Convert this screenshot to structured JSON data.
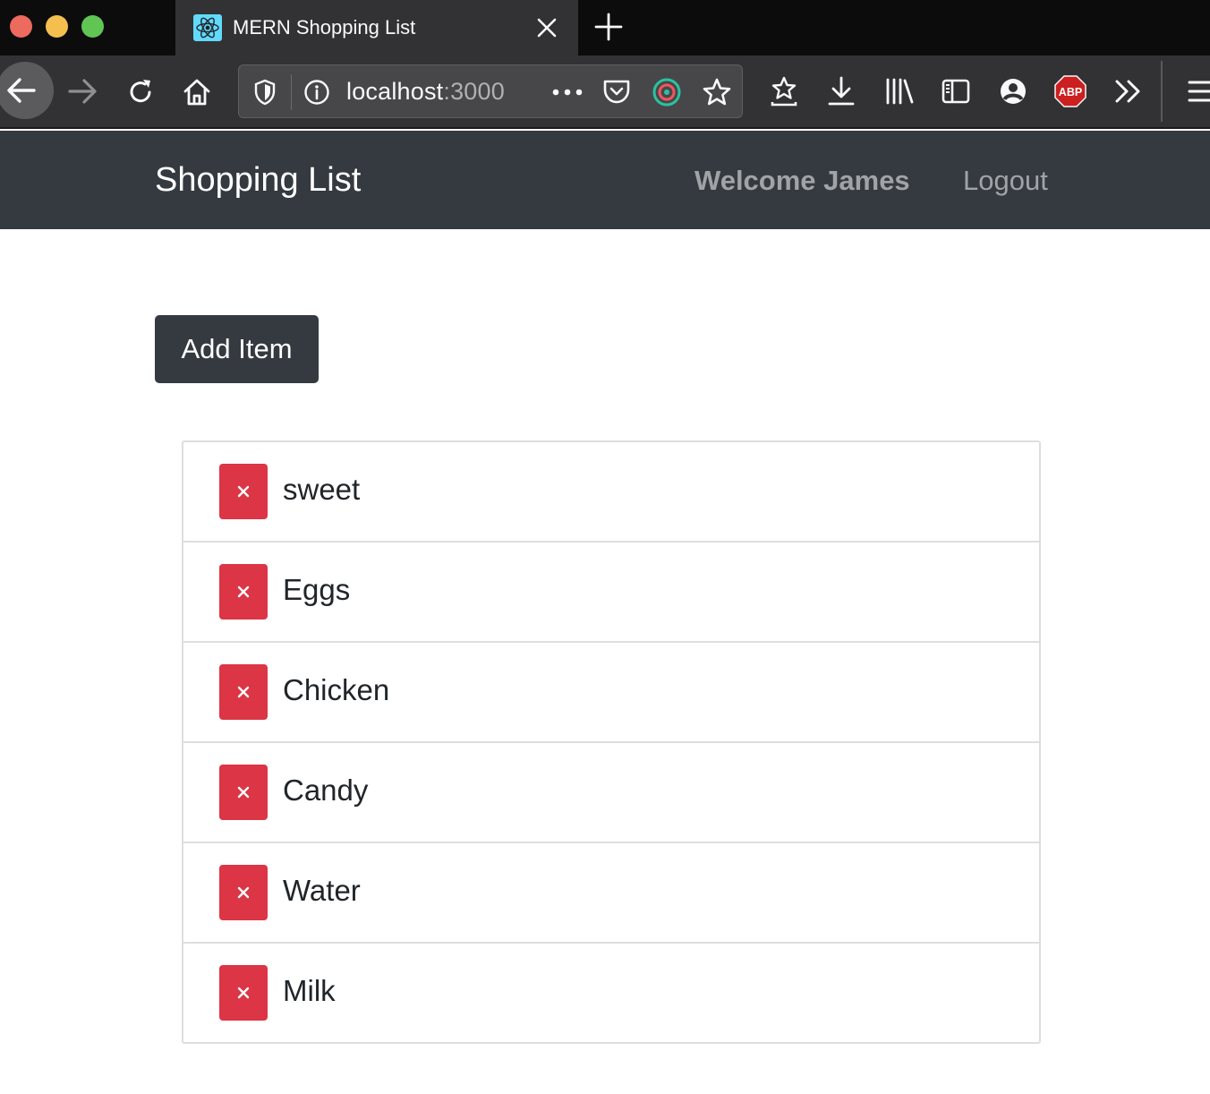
{
  "browser": {
    "tab_title": "MERN Shopping List",
    "url_host": "localhost",
    "url_port": ":3000",
    "adblock_label": "ABP"
  },
  "app": {
    "brand": "Shopping List",
    "welcome": "Welcome James",
    "logout": "Logout",
    "add_item_label": "Add Item",
    "items": [
      {
        "name": "sweet"
      },
      {
        "name": "Eggs"
      },
      {
        "name": "Chicken"
      },
      {
        "name": "Candy"
      },
      {
        "name": "Water"
      },
      {
        "name": "Milk"
      }
    ]
  },
  "colors": {
    "navbar": "#343a40",
    "danger": "#dc3545",
    "tabbar": "#0c0c0d",
    "toolbar": "#323234"
  },
  "icons": {
    "favicon": "react-icon",
    "delete": "close-icon"
  }
}
